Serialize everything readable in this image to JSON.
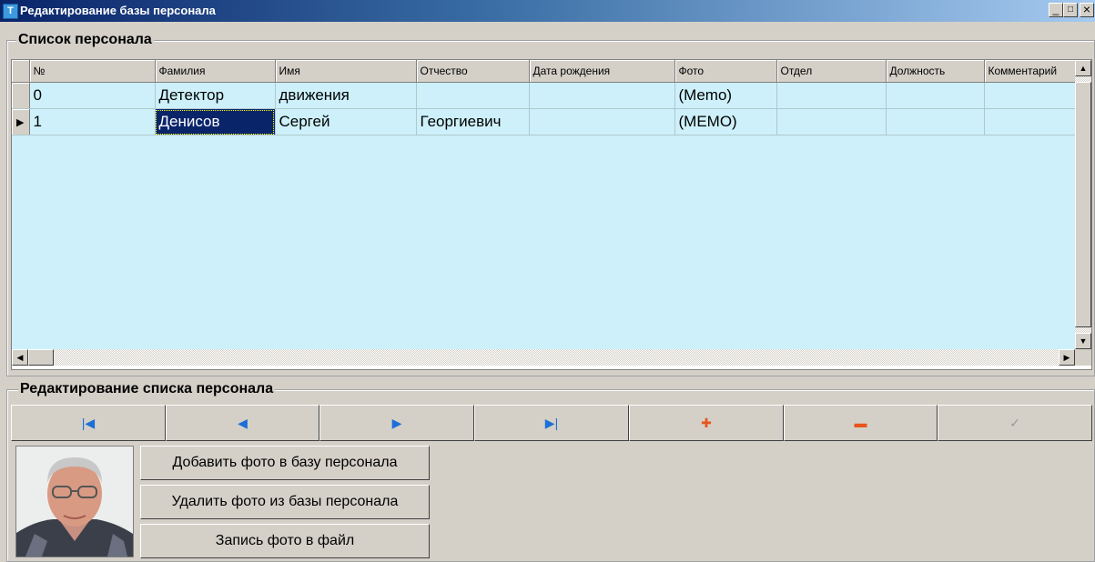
{
  "window": {
    "title": "Редактирование базы персонала",
    "minimize": "_",
    "maximize": "□",
    "close": "×",
    "icon": "app-icon"
  },
  "list_section": {
    "title": "Список персонала",
    "columns": [
      "№",
      "Фамилия",
      "Имя",
      "Отчество",
      "Дата рождения",
      "Фото",
      "Отдел",
      "Должность",
      "Комментарий"
    ],
    "rows": [
      {
        "num": "0",
        "surname": "Детектор",
        "name": "движения",
        "patronymic": "",
        "birthdate": "",
        "photo": "(Memo)",
        "department": "",
        "position": "",
        "comment": ""
      },
      {
        "num": "1",
        "surname": "Денисов",
        "name": "Сергей",
        "patronymic": "Георгиевич",
        "birthdate": "",
        "photo": "(MEMO)",
        "department": "",
        "position": "",
        "comment": ""
      }
    ],
    "current_row_marker": "▶"
  },
  "edit_section": {
    "title": "Редактирование списка персонала",
    "nav_buttons": [
      {
        "name": "first-record-button",
        "icon": "first-icon",
        "glyph": "|◀",
        "color": "#1c6fd6"
      },
      {
        "name": "prior-record-button",
        "icon": "prior-icon",
        "glyph": "◀",
        "color": "#1c6fd6"
      },
      {
        "name": "next-record-button",
        "icon": "next-icon",
        "glyph": "▶",
        "color": "#1c6fd6"
      },
      {
        "name": "last-record-button",
        "icon": "last-icon",
        "glyph": "▶|",
        "color": "#1c6fd6"
      },
      {
        "name": "insert-record-button",
        "icon": "plus-icon",
        "glyph": "✚",
        "color": "#e8541c"
      },
      {
        "name": "delete-record-button",
        "icon": "minus-icon",
        "glyph": "▬",
        "color": "#e8541c"
      },
      {
        "name": "post-record-button",
        "icon": "check-icon",
        "glyph": "✓",
        "color": "#9a9a9a"
      }
    ],
    "actions": {
      "add_photo": "Добавить фото в базу персонала",
      "delete_photo": "Удалить фото из базы персонала",
      "save_photo": "Запись фото в файл"
    }
  }
}
